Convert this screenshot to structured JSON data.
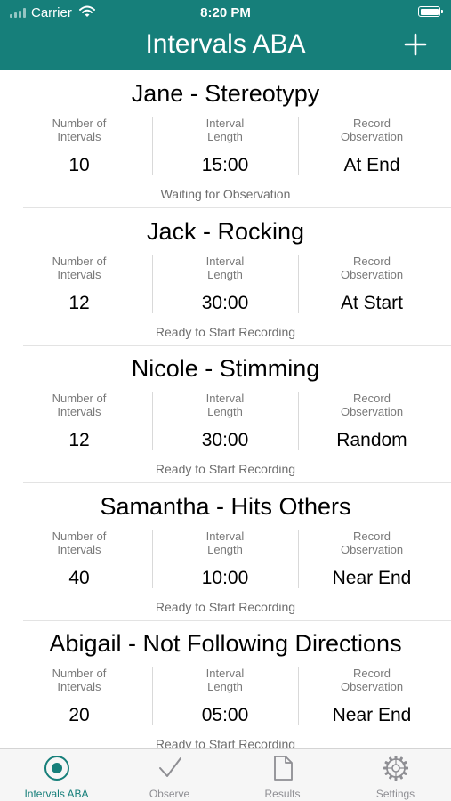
{
  "status_bar": {
    "carrier": "Carrier",
    "time": "8:20 PM"
  },
  "nav": {
    "title": "Intervals ABA"
  },
  "colors": {
    "accent": "#167f7a",
    "inactive": "#8e8e93"
  },
  "intervals": [
    {
      "title": "Jane - Stereotypy",
      "labels": [
        "Number of\nIntervals",
        "Interval\nLength",
        "Record\nObservation"
      ],
      "number_of_intervals": "10",
      "interval_length": "15:00",
      "record_observation": "At End",
      "status": "Waiting for Observation"
    },
    {
      "title": "Jack - Rocking",
      "labels": [
        "Number of\nIntervals",
        "Interval\nLength",
        "Record\nObservation"
      ],
      "number_of_intervals": "12",
      "interval_length": "30:00",
      "record_observation": "At Start",
      "status": "Ready to Start Recording"
    },
    {
      "title": "Nicole - Stimming",
      "labels": [
        "Number of\nIntervals",
        "Interval\nLength",
        "Record\nObservation"
      ],
      "number_of_intervals": "12",
      "interval_length": "30:00",
      "record_observation": "Random",
      "status": "Ready to Start Recording"
    },
    {
      "title": "Samantha - Hits Others",
      "labels": [
        "Number of\nIntervals",
        "Interval\nLength",
        "Record\nObservation"
      ],
      "number_of_intervals": "40",
      "interval_length": "10:00",
      "record_observation": "Near End",
      "status": "Ready to Start Recording"
    },
    {
      "title": "Abigail - Not Following Directions",
      "labels": [
        "Number of\nIntervals",
        "Interval\nLength",
        "Record\nObservation"
      ],
      "number_of_intervals": "20",
      "interval_length": "05:00",
      "record_observation": "Near End",
      "status": "Ready to Start Recording"
    }
  ],
  "tabs": [
    {
      "label": "Intervals ABA",
      "icon": "record-icon",
      "active": true
    },
    {
      "label": "Observe",
      "icon": "checkmark-icon",
      "active": false
    },
    {
      "label": "Results",
      "icon": "document-icon",
      "active": false
    },
    {
      "label": "Settings",
      "icon": "gear-icon",
      "active": false
    }
  ]
}
